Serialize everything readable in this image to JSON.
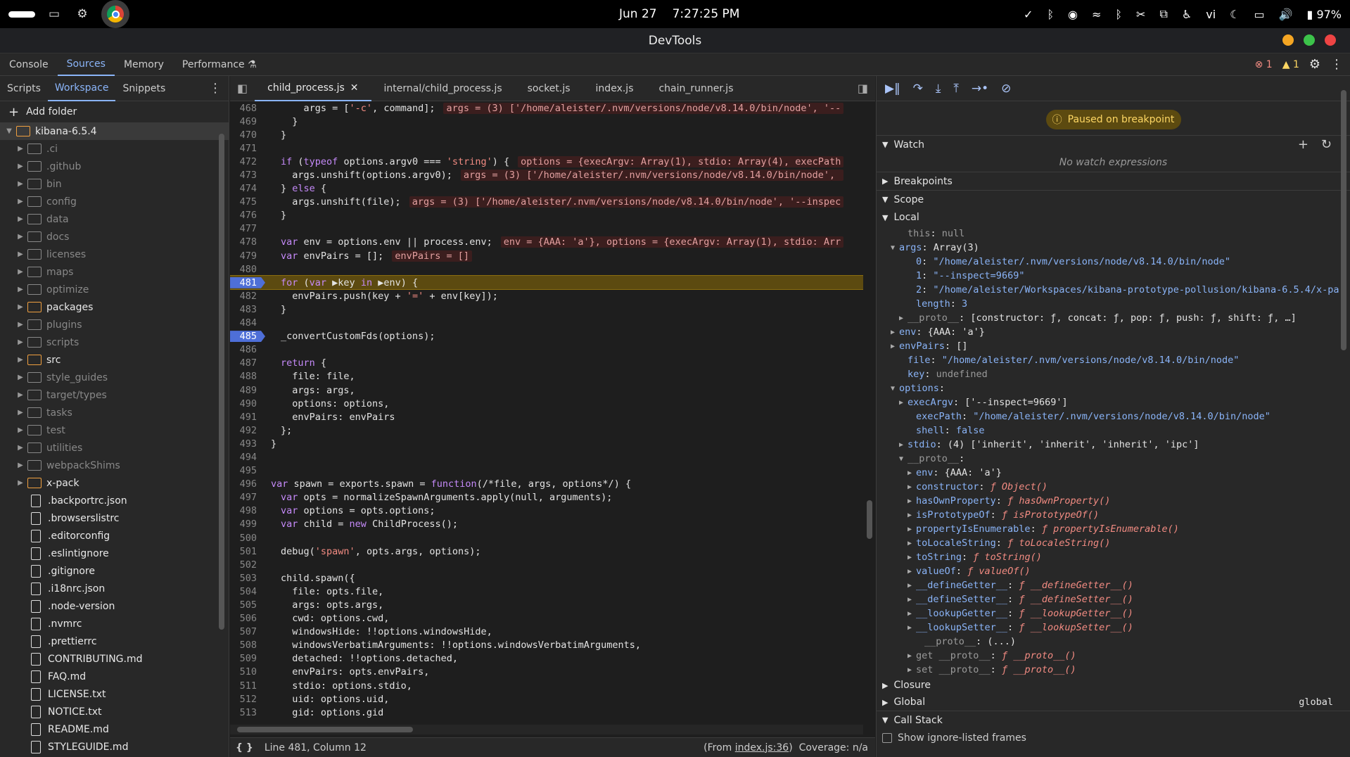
{
  "system": {
    "date": "Jun 27",
    "time": "7:27:25 PM",
    "keyboard": "vi",
    "battery": "97%"
  },
  "window": {
    "title": "DevTools"
  },
  "main_tabs": [
    "Console",
    "Sources",
    "Memory",
    "Performance"
  ],
  "issues": {
    "errors": "1",
    "warnings": "1"
  },
  "left": {
    "tabs": [
      "Scripts",
      "Workspace",
      "Snippets"
    ],
    "add_folder": "Add folder",
    "tree": [
      {
        "name": "kibana-6.5.4",
        "kind": "root"
      },
      {
        "name": ".ci",
        "kind": "folder"
      },
      {
        "name": ".github",
        "kind": "folder"
      },
      {
        "name": "bin",
        "kind": "folder"
      },
      {
        "name": "config",
        "kind": "folder"
      },
      {
        "name": "data",
        "kind": "folder"
      },
      {
        "name": "docs",
        "kind": "folder"
      },
      {
        "name": "licenses",
        "kind": "folder"
      },
      {
        "name": "maps",
        "kind": "folder"
      },
      {
        "name": "optimize",
        "kind": "folder"
      },
      {
        "name": "packages",
        "kind": "ofolder"
      },
      {
        "name": "plugins",
        "kind": "folder"
      },
      {
        "name": "scripts",
        "kind": "folder"
      },
      {
        "name": "src",
        "kind": "ofolder"
      },
      {
        "name": "style_guides",
        "kind": "folder"
      },
      {
        "name": "target/types",
        "kind": "folder"
      },
      {
        "name": "tasks",
        "kind": "folder"
      },
      {
        "name": "test",
        "kind": "folder"
      },
      {
        "name": "utilities",
        "kind": "folder"
      },
      {
        "name": "webpackShims",
        "kind": "folder"
      },
      {
        "name": "x-pack",
        "kind": "ofolder"
      },
      {
        "name": ".backportrc.json",
        "kind": "file"
      },
      {
        "name": ".browserslistrc",
        "kind": "file"
      },
      {
        "name": ".editorconfig",
        "kind": "file"
      },
      {
        "name": ".eslintignore",
        "kind": "file"
      },
      {
        "name": ".gitignore",
        "kind": "file"
      },
      {
        "name": ".i18nrc.json",
        "kind": "file"
      },
      {
        "name": ".node-version",
        "kind": "file"
      },
      {
        "name": ".nvmrc",
        "kind": "file"
      },
      {
        "name": ".prettierrc",
        "kind": "file"
      },
      {
        "name": "CONTRIBUTING.md",
        "kind": "file"
      },
      {
        "name": "FAQ.md",
        "kind": "file"
      },
      {
        "name": "LICENSE.txt",
        "kind": "file"
      },
      {
        "name": "NOTICE.txt",
        "kind": "file"
      },
      {
        "name": "README.md",
        "kind": "file"
      },
      {
        "name": "STYLEGUIDE.md",
        "kind": "file"
      }
    ]
  },
  "editor": {
    "tabs": [
      "child_process.js",
      "internal/child_process.js",
      "socket.js",
      "index.js",
      "chain_runner.js"
    ],
    "lines": [
      {
        "n": "468",
        "html": "    args = ['-c', command];",
        "inline": "args = (3) ['/home/aleister/.nvm/versions/node/v8.14.0/bin/node', '--"
      },
      {
        "n": "469",
        "html": "  }"
      },
      {
        "n": "470",
        "html": "}"
      },
      {
        "n": "471",
        "html": ""
      },
      {
        "n": "472",
        "html": "if (typeof options.argv0 === 'string') {",
        "inline": "options = {execArgv: Array(1), stdio: Array(4), execPath"
      },
      {
        "n": "473",
        "html": "  args.unshift(options.argv0);",
        "inline": "args = (3) ['/home/aleister/.nvm/versions/node/v8.14.0/bin/node', "
      },
      {
        "n": "474",
        "html": "} else {"
      },
      {
        "n": "475",
        "html": "  args.unshift(file);",
        "inline": "args = (3) ['/home/aleister/.nvm/versions/node/v8.14.0/bin/node', '--inspec"
      },
      {
        "n": "476",
        "html": "}"
      },
      {
        "n": "477",
        "html": ""
      },
      {
        "n": "478",
        "html": "var env = options.env || process.env;",
        "inline": "env = {AAA: 'a'}, options = {execArgv: Array(1), stdio: Arr"
      },
      {
        "n": "479",
        "html": "var envPairs = [];",
        "inline": "envPairs = []"
      },
      {
        "n": "480",
        "html": ""
      },
      {
        "n": "481",
        "html": "for (var ▶key in ▶env) {",
        "bp": true,
        "exec": true
      },
      {
        "n": "482",
        "html": "  envPairs.push(key + '=' + env[key]);"
      },
      {
        "n": "483",
        "html": "}"
      },
      {
        "n": "484",
        "html": ""
      },
      {
        "n": "485",
        "html": "_convertCustomFds(options);",
        "bp": true
      },
      {
        "n": "486",
        "html": ""
      },
      {
        "n": "487",
        "html": "return {"
      },
      {
        "n": "488",
        "html": "  file: file,"
      },
      {
        "n": "489",
        "html": "  args: args,"
      },
      {
        "n": "490",
        "html": "  options: options,"
      },
      {
        "n": "491",
        "html": "  envPairs: envPairs"
      },
      {
        "n": "492",
        "html": "};"
      },
      {
        "n": "493",
        "html": "}",
        "outer": true
      },
      {
        "n": "494",
        "html": ""
      },
      {
        "n": "495",
        "html": ""
      },
      {
        "n": "496",
        "html": "var spawn = exports.spawn = function(/*file, args, options*/) {",
        "outer": true
      },
      {
        "n": "497",
        "html": "var opts = normalizeSpawnArguments.apply(null, arguments);"
      },
      {
        "n": "498",
        "html": "var options = opts.options;"
      },
      {
        "n": "499",
        "html": "var child = new ChildProcess();"
      },
      {
        "n": "500",
        "html": ""
      },
      {
        "n": "501",
        "html": "debug('spawn', opts.args, options);"
      },
      {
        "n": "502",
        "html": ""
      },
      {
        "n": "503",
        "html": "child.spawn({"
      },
      {
        "n": "504",
        "html": "  file: opts.file,"
      },
      {
        "n": "505",
        "html": "  args: opts.args,"
      },
      {
        "n": "506",
        "html": "  cwd: options.cwd,"
      },
      {
        "n": "507",
        "html": "  windowsHide: !!options.windowsHide,"
      },
      {
        "n": "508",
        "html": "  windowsVerbatimArguments: !!options.windowsVerbatimArguments,"
      },
      {
        "n": "509",
        "html": "  detached: !!options.detached,"
      },
      {
        "n": "510",
        "html": "  envPairs: opts.envPairs,"
      },
      {
        "n": "511",
        "html": "  stdio: options.stdio,"
      },
      {
        "n": "512",
        "html": "  uid: options.uid,"
      },
      {
        "n": "513",
        "html": "  gid: options.gid"
      }
    ],
    "status": {
      "position": "Line 481, Column 12",
      "from_prefix": "(From ",
      "from_link": "index.js:36",
      "from_suffix": ")",
      "coverage": "Coverage: n/a"
    }
  },
  "debugger": {
    "paused": "Paused on breakpoint",
    "watch_title": "Watch",
    "no_watch": "No watch expressions",
    "breakpoints_title": "Breakpoints",
    "scope_title": "Scope",
    "local_title": "Local",
    "scope_rows": [
      {
        "i": 2,
        "t": "",
        "k": "this",
        "v": "null",
        "vk": "nul",
        "dim": true
      },
      {
        "i": 1,
        "t": "▼",
        "k": "args",
        "v": "Array(3)"
      },
      {
        "i": 3,
        "t": "",
        "k": "0",
        "v": "\"/home/aleister/.nvm/versions/node/v8.14.0/bin/node\"",
        "vk": "str"
      },
      {
        "i": 3,
        "t": "",
        "k": "1",
        "v": "\"--inspect=9669\"",
        "vk": "str"
      },
      {
        "i": 3,
        "t": "",
        "k": "2",
        "v": "\"/home/aleister/Workspaces/kibana-prototype-pollusion/kibana-6.5.4/x-pa",
        "vk": "str"
      },
      {
        "i": 3,
        "t": "",
        "k": "length",
        "v": "3",
        "vk": "num"
      },
      {
        "i": 2,
        "t": "▶",
        "k": "__proto__",
        "v": "[constructor: ƒ, concat: ƒ, pop: ƒ, push: ƒ, shift: ƒ, …]",
        "dim": true
      },
      {
        "i": 1,
        "t": "▶",
        "k": "env",
        "v": "{AAA: 'a'}"
      },
      {
        "i": 1,
        "t": "▶",
        "k": "envPairs",
        "v": "[]"
      },
      {
        "i": 2,
        "t": "",
        "k": "file",
        "v": "\"/home/aleister/.nvm/versions/node/v8.14.0/bin/node\"",
        "vk": "str"
      },
      {
        "i": 2,
        "t": "",
        "k": "key",
        "v": "undefined",
        "vk": "nul"
      },
      {
        "i": 1,
        "t": "▼",
        "k": "options",
        "v": ""
      },
      {
        "i": 2,
        "t": "▶",
        "k": "execArgv",
        "v": "['--inspect=9669']"
      },
      {
        "i": 3,
        "t": "",
        "k": "execPath",
        "v": "\"/home/aleister/.nvm/versions/node/v8.14.0/bin/node\"",
        "vk": "str"
      },
      {
        "i": 3,
        "t": "",
        "k": "shell",
        "v": "false",
        "vk": "num"
      },
      {
        "i": 2,
        "t": "▶",
        "k": "stdio",
        "v": "(4) ['inherit', 'inherit', 'inherit', 'ipc']"
      },
      {
        "i": 2,
        "t": "▼",
        "k": "__proto__",
        "v": "",
        "dim": true
      },
      {
        "i": 3,
        "t": "▶",
        "k": "env",
        "v": "{AAA: 'a'}"
      },
      {
        "i": 3,
        "t": "▶",
        "k": "constructor",
        "v": "ƒ Object()",
        "vk": "fn"
      },
      {
        "i": 3,
        "t": "▶",
        "k": "hasOwnProperty",
        "v": "ƒ hasOwnProperty()",
        "vk": "fn"
      },
      {
        "i": 3,
        "t": "▶",
        "k": "isPrototypeOf",
        "v": "ƒ isPrototypeOf()",
        "vk": "fn"
      },
      {
        "i": 3,
        "t": "▶",
        "k": "propertyIsEnumerable",
        "v": "ƒ propertyIsEnumerable()",
        "vk": "fn"
      },
      {
        "i": 3,
        "t": "▶",
        "k": "toLocaleString",
        "v": "ƒ toLocaleString()",
        "vk": "fn"
      },
      {
        "i": 3,
        "t": "▶",
        "k": "toString",
        "v": "ƒ toString()",
        "vk": "fn"
      },
      {
        "i": 3,
        "t": "▶",
        "k": "valueOf",
        "v": "ƒ valueOf()",
        "vk": "fn"
      },
      {
        "i": 3,
        "t": "▶",
        "k": "__defineGetter__",
        "v": "ƒ __defineGetter__()",
        "vk": "fn"
      },
      {
        "i": 3,
        "t": "▶",
        "k": "__defineSetter__",
        "v": "ƒ __defineSetter__()",
        "vk": "fn"
      },
      {
        "i": 3,
        "t": "▶",
        "k": "__lookupGetter__",
        "v": "ƒ __lookupGetter__()",
        "vk": "fn"
      },
      {
        "i": 3,
        "t": "▶",
        "k": "__lookupSetter__",
        "v": "ƒ __lookupSetter__()",
        "vk": "fn"
      },
      {
        "i": 4,
        "t": "",
        "k": "__proto__",
        "v": "(...)",
        "dim": true
      },
      {
        "i": 3,
        "t": "▶",
        "k": "get __proto__",
        "v": "ƒ __proto__()",
        "vk": "fn",
        "dim": true
      },
      {
        "i": 3,
        "t": "▶",
        "k": "set __proto__",
        "v": "ƒ __proto__()",
        "vk": "fn",
        "dim": true
      }
    ],
    "closure_title": "Closure",
    "global_title": "Global",
    "global_value": "global",
    "callstack_title": "Call Stack",
    "show_ignore": "Show ignore-listed frames"
  }
}
